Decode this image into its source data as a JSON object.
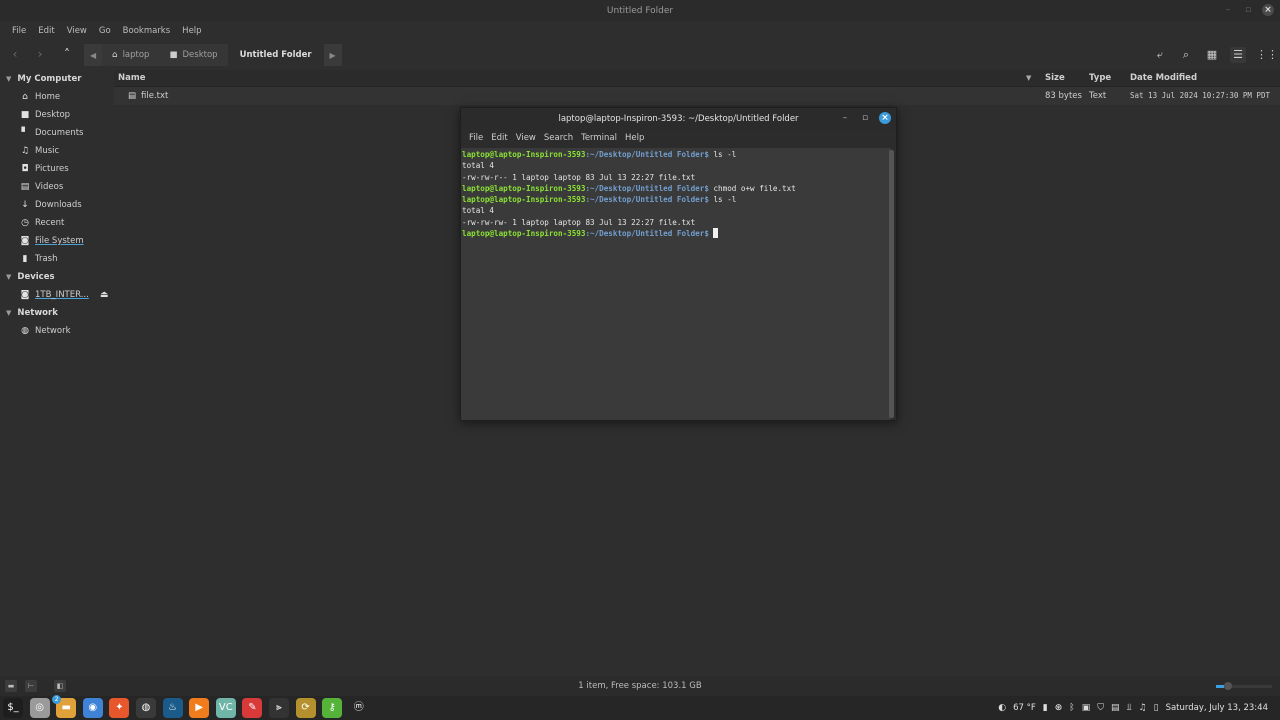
{
  "file_manager": {
    "window_title": "Untitled Folder",
    "menu": [
      "File",
      "Edit",
      "View",
      "Go",
      "Bookmarks",
      "Help"
    ],
    "breadcrumbs": [
      {
        "label": "laptop",
        "icon": "home-icon"
      },
      {
        "label": "Desktop",
        "icon": "desktop-icon"
      },
      {
        "label": "Untitled Folder",
        "icon": ""
      }
    ],
    "sidebar": {
      "sections": [
        {
          "title": "My Computer",
          "items": [
            {
              "label": "Home",
              "icon": "home-icon"
            },
            {
              "label": "Desktop",
              "icon": "desktop-icon"
            },
            {
              "label": "Documents",
              "icon": "document-icon"
            },
            {
              "label": "Music",
              "icon": "music-icon"
            },
            {
              "label": "Pictures",
              "icon": "camera-icon"
            },
            {
              "label": "Videos",
              "icon": "film-icon"
            },
            {
              "label": "Downloads",
              "icon": "download-icon"
            },
            {
              "label": "Recent",
              "icon": "clock-icon"
            },
            {
              "label": "File System",
              "icon": "drive-icon"
            },
            {
              "label": "Trash",
              "icon": "trash-icon"
            }
          ]
        },
        {
          "title": "Devices",
          "items": [
            {
              "label": "1TB_INTER...",
              "icon": "drive-icon"
            }
          ]
        },
        {
          "title": "Network",
          "items": [
            {
              "label": "Network",
              "icon": "globe-icon"
            }
          ]
        }
      ]
    },
    "columns": {
      "name": "Name",
      "size": "Size",
      "type": "Type",
      "date": "Date Modified"
    },
    "files": [
      {
        "name": "file.txt",
        "size": "83 bytes",
        "type": "Text",
        "date": "Sat 13 Jul 2024 10:27:30 PM PDT"
      }
    ],
    "status": "1 item, Free space: 103.1 GB"
  },
  "terminal": {
    "title": "laptop@laptop-Inspiron-3593: ~/Desktop/Untitled Folder",
    "menu": [
      "File",
      "Edit",
      "View",
      "Search",
      "Terminal",
      "Help"
    ],
    "prompt_user": "laptop@laptop-Inspiron-3593",
    "prompt_path": ":~/Desktop/Untitled Folder$",
    "lines": [
      {
        "type": "prompt",
        "cmd": " ls -l"
      },
      {
        "type": "out",
        "text": "total 4"
      },
      {
        "type": "out",
        "text": "-rw-rw-r-- 1 laptop laptop 83 Jul 13 22:27 file.txt"
      },
      {
        "type": "prompt",
        "cmd": " chmod o+w file.txt"
      },
      {
        "type": "prompt",
        "cmd": " ls -l"
      },
      {
        "type": "out",
        "text": "total 4"
      },
      {
        "type": "out",
        "text": "-rw-rw-rw- 1 laptop laptop 83 Jul 13 22:27 file.txt"
      },
      {
        "type": "prompt",
        "cmd": " "
      }
    ]
  },
  "taskbar": {
    "apps": [
      {
        "name": "terminal",
        "glyph": "$_",
        "color": "#1e1e1e"
      },
      {
        "name": "disks",
        "glyph": "◎",
        "color": "#9a9a9a"
      },
      {
        "name": "files",
        "glyph": "▬",
        "color": "#e0a13a",
        "badge": "2"
      },
      {
        "name": "chrome",
        "glyph": "◉",
        "color": "#3e83d6"
      },
      {
        "name": "firefox",
        "glyph": "✦",
        "color": "#e8572b"
      },
      {
        "name": "obs",
        "glyph": "◍",
        "color": "#3a3a3a"
      },
      {
        "name": "steam",
        "glyph": "♨",
        "color": "#1b5b8a"
      },
      {
        "name": "media-player",
        "glyph": "▶",
        "color": "#f07c1e"
      },
      {
        "name": "vscode",
        "glyph": "VC",
        "color": "#6fb5a8"
      },
      {
        "name": "gimp-like",
        "glyph": "✎",
        "color": "#d83a3a"
      },
      {
        "name": "video-editor",
        "glyph": "⫸",
        "color": "#333"
      },
      {
        "name": "update-manager",
        "glyph": "⟳",
        "color": "#b5912d"
      },
      {
        "name": "key-manager",
        "glyph": "⚷",
        "color": "#55b33a"
      },
      {
        "name": "mint-menu",
        "glyph": "ⓜ",
        "color": "#262626"
      }
    ],
    "weather": "67 °F",
    "clock": "Saturday, July 13, 23:44"
  }
}
